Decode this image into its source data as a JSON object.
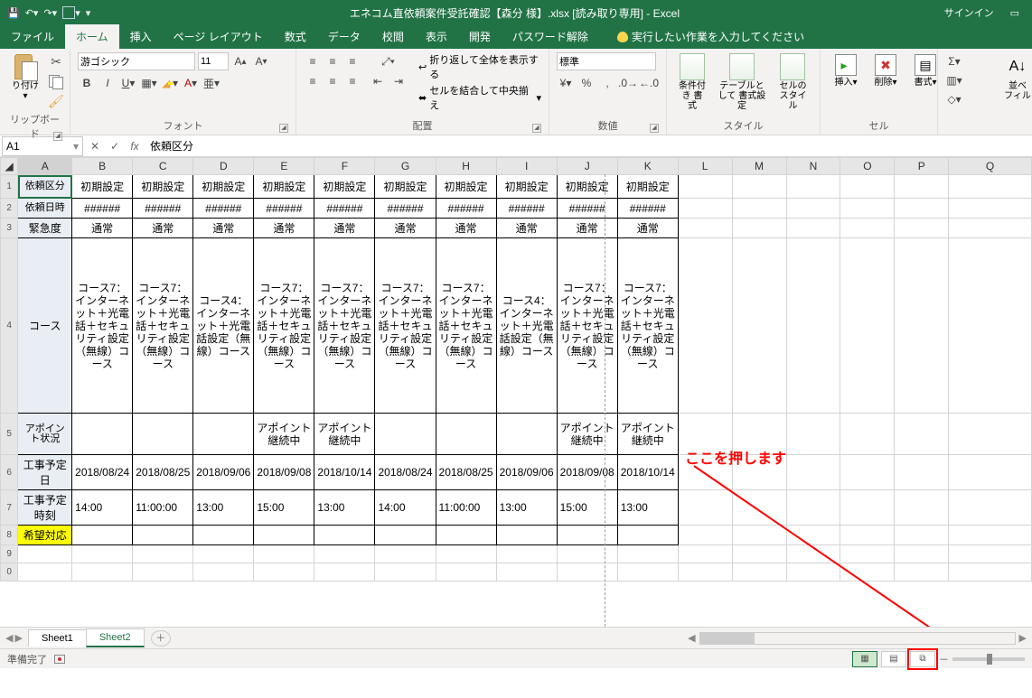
{
  "titlebar": {
    "title": "エネコム直依頼案件受託確認【森分  様】.xlsx  [読み取り専用]  -  Excel",
    "signin": "サインイン"
  },
  "tabs": {
    "file": "ファイル",
    "home": "ホーム",
    "insert": "挿入",
    "pagelayout": "ページ レイアウト",
    "formulas": "数式",
    "data": "データ",
    "review": "校閲",
    "view": "表示",
    "developer": "開発",
    "password": "パスワード解除",
    "tellme": "実行したい作業を入力してください"
  },
  "ribbon": {
    "clipboard": {
      "paste": "り付け",
      "label": "リップボード"
    },
    "font": {
      "name": "游ゴシック",
      "size": "11",
      "label": "フォント"
    },
    "align": {
      "wrap": "折り返して全体を表示する",
      "merge": "セルを結合して中央揃え",
      "label": "配置"
    },
    "number": {
      "fmt": "標準",
      "label": "数値"
    },
    "styles": {
      "cond": "条件付き\n書式",
      "table": "テーブルとして\n書式設定",
      "cell": "セルの\nスタイル",
      "label": "スタイル"
    },
    "cells": {
      "insert": "挿入",
      "delete": "削除",
      "format": "書式",
      "label": "セル"
    },
    "editing": {
      "sort": "並べ\nフィル"
    }
  },
  "formulabar": {
    "name": "A1",
    "value": "依頼区分"
  },
  "columns": [
    "A",
    "B",
    "C",
    "D",
    "E",
    "F",
    "G",
    "H",
    "I",
    "J",
    "K",
    "L",
    "M",
    "N",
    "O",
    "P",
    "Q"
  ],
  "rows": {
    "r1": {
      "label": "依頼区分",
      "vals": [
        "初期設定",
        "初期設定",
        "初期設定",
        "初期設定",
        "初期設定",
        "初期設定",
        "初期設定",
        "初期設定",
        "初期設定",
        "初期設定"
      ]
    },
    "r2": {
      "label": "依頼日時",
      "vals": [
        "######",
        "######",
        "######",
        "######",
        "######",
        "######",
        "######",
        "######",
        "######",
        "######"
      ]
    },
    "r3": {
      "label": "緊急度",
      "vals": [
        "通常",
        "通常",
        "通常",
        "通常",
        "通常",
        "通常",
        "通常",
        "通常",
        "通常",
        "通常"
      ]
    },
    "r4": {
      "label": "コース",
      "vals": [
        "コース7：インターネット＋光電話＋セキュリティ設定（無線）コース",
        "コース7：インターネット＋光電話＋セキュリティ設定（無線）コース",
        "コース4：インターネット＋光電話設定（無線）コース",
        "コース7：インターネット＋光電話＋セキュリティ設定（無線）コース",
        "コース7：インターネット＋光電話＋セキュリティ設定（無線）コース",
        "コース7：インターネット＋光電話＋セキュリティ設定（無線）コース",
        "コース7：インターネット＋光電話＋セキュリティ設定（無線）コース",
        "コース4：インターネット＋光電話設定（無線）コース",
        "コース7：インターネット＋光電話＋セキュリティ設定（無線）コース",
        "コース7：インターネット＋光電話＋セキュリティ設定（無線）コース"
      ]
    },
    "r5": {
      "label": "アポイント状況",
      "vals": [
        "",
        "",
        "",
        "アポイント継続中",
        "アポイント継続中",
        "",
        "",
        "",
        "アポイント継続中",
        "アポイント継続中"
      ]
    },
    "r6": {
      "label": "工事予定日",
      "vals": [
        "2018/08/24",
        "2018/08/25",
        "2018/09/06",
        "2018/09/08",
        "2018/10/14",
        "2018/08/24",
        "2018/08/25",
        "2018/09/06",
        "2018/09/08",
        "2018/10/14"
      ]
    },
    "r7": {
      "label": "工事予定時刻",
      "vals": [
        "14:00",
        "11:00:00",
        "13:00",
        "15:00",
        "13:00",
        "14:00",
        "11:00:00",
        "13:00",
        "15:00",
        "13:00"
      ]
    },
    "r8": {
      "label": "希望対応",
      "vals": [
        "",
        "",
        "",
        "",
        "",
        "",
        "",
        "",
        "",
        ""
      ]
    }
  },
  "annotation": {
    "text": "ここを押します"
  },
  "sheettabs": {
    "s1": "Sheet1",
    "s2": "Sheet2"
  },
  "status": {
    "ready": "準備完了"
  }
}
